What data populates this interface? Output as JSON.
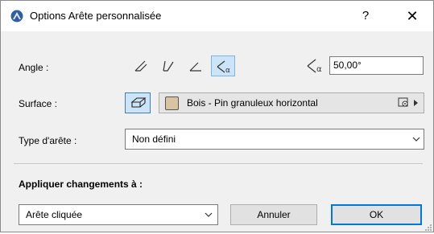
{
  "title": "Options Arête personnalisée",
  "titlebar": {
    "help_label": "?",
    "close_label": "✕"
  },
  "angle": {
    "label": "Angle :",
    "icons": [
      "edge-angle-1-icon",
      "edge-angle-2-icon",
      "edge-angle-3-icon",
      "edge-angle-custom-icon"
    ],
    "selected_index": 3,
    "value": "50,00°"
  },
  "surface": {
    "label": "Surface :",
    "name": "Bois - Pin granuleux horizontal",
    "swatch_color": "#d9c4a2"
  },
  "edge_type": {
    "label": "Type d'arête :",
    "value": "Non défini"
  },
  "apply": {
    "label": "Appliquer changements à :",
    "target": "Arête cliquée"
  },
  "buttons": {
    "cancel": "Annuler",
    "ok": "OK"
  },
  "colors": {
    "selected_bg": "#cce4f7",
    "selected_border": "#7eb4ea",
    "accent": "#0078d7",
    "title_icon": "#2f5f9f"
  }
}
